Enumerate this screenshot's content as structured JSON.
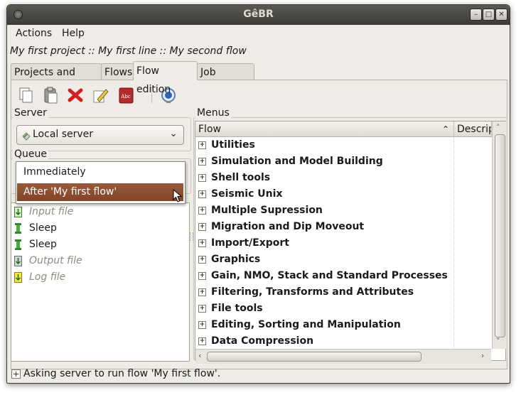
{
  "window": {
    "title": "GêBR",
    "buttons": [
      "minimize",
      "maximize",
      "close"
    ]
  },
  "menubar": {
    "items": [
      "Actions",
      "Help"
    ]
  },
  "breadcrumb": "My first project :: My first line :: My second flow",
  "tabs": [
    {
      "label": "Projects and Lines",
      "active": false
    },
    {
      "label": "Flows",
      "active": false
    },
    {
      "label": "Flow edition",
      "active": true
    },
    {
      "label": "Job control",
      "active": false
    }
  ],
  "toolbar": {
    "icons": [
      "copy-icon",
      "paste-icon",
      "delete-icon",
      "edit-icon",
      "dictionary-icon",
      "run-icon"
    ]
  },
  "server": {
    "legend": "Server",
    "selected": "Local server"
  },
  "queue": {
    "legend": "Queue",
    "options": [
      "Immediately",
      "After 'My first flow'"
    ],
    "highlighted": "After 'My first flow'"
  },
  "programs": [
    {
      "label": "Input file",
      "enabled": false,
      "icon": "input-file-icon"
    },
    {
      "label": "Sleep",
      "enabled": true,
      "icon": "program-icon"
    },
    {
      "label": "Sleep",
      "enabled": true,
      "icon": "program-icon"
    },
    {
      "label": "Output file",
      "enabled": false,
      "icon": "output-file-icon"
    },
    {
      "label": "Log file",
      "enabled": false,
      "icon": "log-file-icon"
    }
  ],
  "menus": {
    "legend": "Menus",
    "columns": [
      "Flow",
      "Descrip"
    ],
    "categories": [
      "Utilities",
      "Simulation and Model Building",
      "Shell tools",
      "Seismic Unix",
      "Multiple Supression",
      "Migration and Dip Moveout",
      "Import/Export",
      "Graphics",
      "Gain, NMO, Stack and Standard Processes",
      "Filtering, Transforms and Attributes",
      "File tools",
      "Editing, Sorting and Manipulation",
      "Data Compression"
    ]
  },
  "statusbar": {
    "message": "Asking server to run flow 'My first flow'."
  },
  "colors": {
    "highlight": "#8a4b2e",
    "titlebar": "#3c3b37",
    "window_bg": "#efebe7"
  }
}
